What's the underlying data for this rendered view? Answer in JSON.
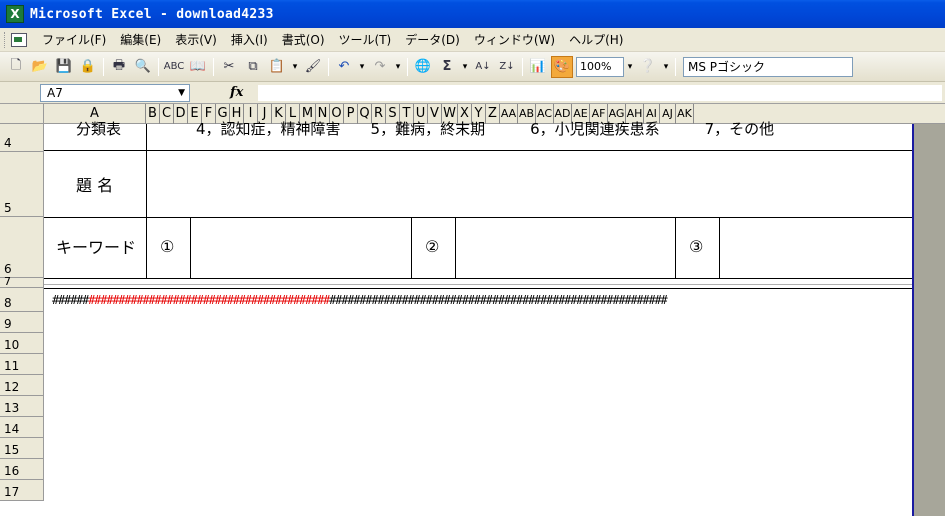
{
  "window": {
    "title": "Microsoft Excel - download4233"
  },
  "menubar": {
    "items": [
      "ファイル(F)",
      "編集(E)",
      "表示(V)",
      "挿入(I)",
      "書式(O)",
      "ツール(T)",
      "データ(D)",
      "ウィンドウ(W)",
      "ヘルプ(H)"
    ]
  },
  "toolbar": {
    "zoom": "100%",
    "font_name": "MS Pゴシック",
    "sigma": "Σ"
  },
  "formula_bar": {
    "name_box": "A7",
    "fx_label": "fx"
  },
  "columns": [
    "A",
    "B",
    "C",
    "D",
    "E",
    "F",
    "G",
    "H",
    "I",
    "J",
    "K",
    "L",
    "M",
    "N",
    "O",
    "P",
    "Q",
    "R",
    "S",
    "T",
    "U",
    "V",
    "W",
    "X",
    "Y",
    "Z",
    "AA",
    "AB",
    "AC",
    "AD",
    "AE",
    "AF",
    "AG",
    "AH",
    "AI",
    "AJ",
    "AK"
  ],
  "rows": [
    "4",
    "5",
    "6",
    "7",
    "8",
    "9",
    "10",
    "11",
    "12",
    "13",
    "14",
    "15",
    "16",
    "17"
  ],
  "cells": {
    "row4_label": "分類表",
    "row4_text": "4，認知症，精神障害　　5，難病，終末期　　　6，小児関連疾患系　　　7，その他",
    "title_label": "題 名",
    "keyword_label": "キーワード",
    "circle1": "①",
    "circle2": "②",
    "circle3": "③"
  },
  "hash_row": {
    "black_prefix": "######",
    "red_part": "########################################",
    "black_suffix": "########################################################"
  }
}
